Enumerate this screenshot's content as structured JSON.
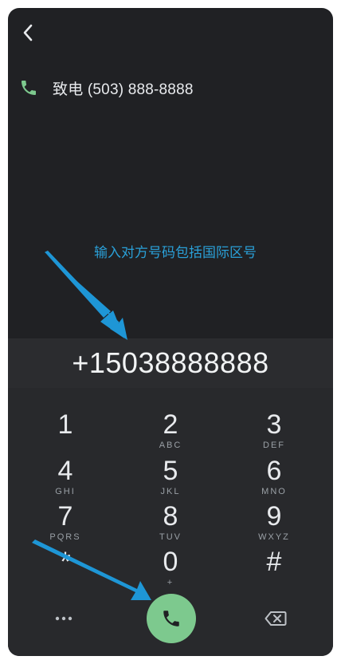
{
  "suggestion": {
    "text": "致电 (503) 888-8888"
  },
  "annotation": {
    "text": "输入对方号码包括国际区号"
  },
  "dialer": {
    "number": "+15038888888"
  },
  "keypad": {
    "keys": [
      {
        "digit": "1",
        "letters": ""
      },
      {
        "digit": "2",
        "letters": "ABC"
      },
      {
        "digit": "3",
        "letters": "DEF"
      },
      {
        "digit": "4",
        "letters": "GHI"
      },
      {
        "digit": "5",
        "letters": "JKL"
      },
      {
        "digit": "6",
        "letters": "MNO"
      },
      {
        "digit": "7",
        "letters": "PQRS"
      },
      {
        "digit": "8",
        "letters": "TUV"
      },
      {
        "digit": "9",
        "letters": "WXYZ"
      },
      {
        "digit": "*",
        "letters": ""
      },
      {
        "digit": "0",
        "letters": "+"
      },
      {
        "digit": "#",
        "letters": ""
      }
    ]
  },
  "icons": {
    "back": "chevron-left-icon",
    "suggestion_phone": "phone-icon",
    "call": "phone-icon",
    "more": "more-horizontal-icon",
    "backspace": "backspace-icon"
  },
  "colors": {
    "background": "#202124",
    "accent_green": "#7dc98e",
    "annotation_blue": "#2aa0d8"
  }
}
